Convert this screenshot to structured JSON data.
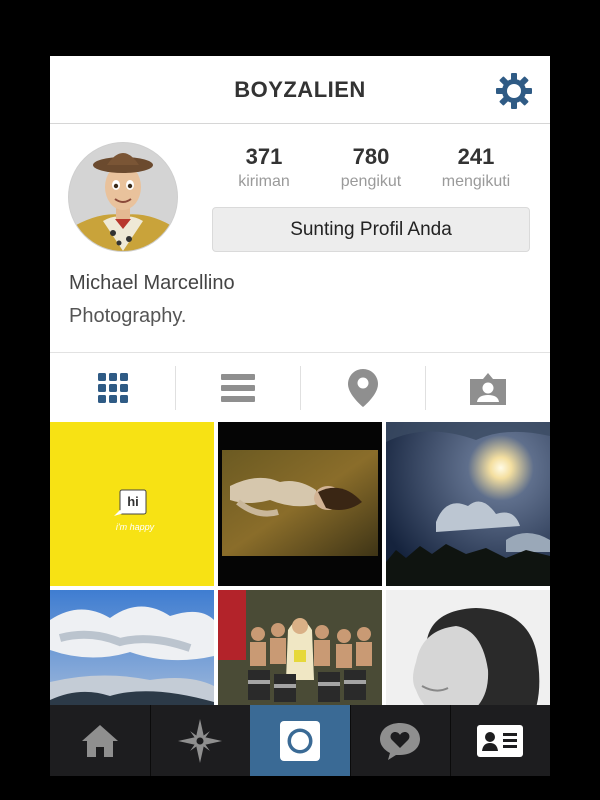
{
  "header": {
    "title": "BOYZALIEN",
    "settings_icon": "gear-icon"
  },
  "profile": {
    "stats": [
      {
        "value": "371",
        "label": "kiriman"
      },
      {
        "value": "780",
        "label": "pengikut"
      },
      {
        "value": "241",
        "label": "mengikuti"
      }
    ],
    "edit_button_label": "Sunting Profil Anda",
    "full_name": "Michael Marcellino",
    "bio": "Photography."
  },
  "tabs": [
    {
      "name": "grid-view",
      "icon": "grid-icon",
      "active": true
    },
    {
      "name": "list-view",
      "icon": "list-icon",
      "active": false
    },
    {
      "name": "photo-map",
      "icon": "location-pin-icon",
      "active": false
    },
    {
      "name": "photos-of-you",
      "icon": "tagged-person-icon",
      "active": false
    }
  ],
  "posts": [
    {
      "thumb_text": "hi",
      "thumb_caption": "i'm happy"
    }
  ],
  "nav": [
    {
      "name": "home",
      "icon": "home-icon",
      "active": false
    },
    {
      "name": "explore",
      "icon": "compass-star-icon",
      "active": false
    },
    {
      "name": "camera",
      "icon": "camera-icon",
      "active": true
    },
    {
      "name": "activity",
      "icon": "heart-bubble-icon",
      "active": false
    },
    {
      "name": "profile",
      "icon": "profile-card-icon",
      "active": false
    }
  ],
  "colors": {
    "accent": "#2f5b85",
    "nav_active": "#3a6a95",
    "nav_bg": "#1d1d1f",
    "tab_inactive": "#8f8f8f",
    "thumb_yellow": "#f7e214"
  }
}
